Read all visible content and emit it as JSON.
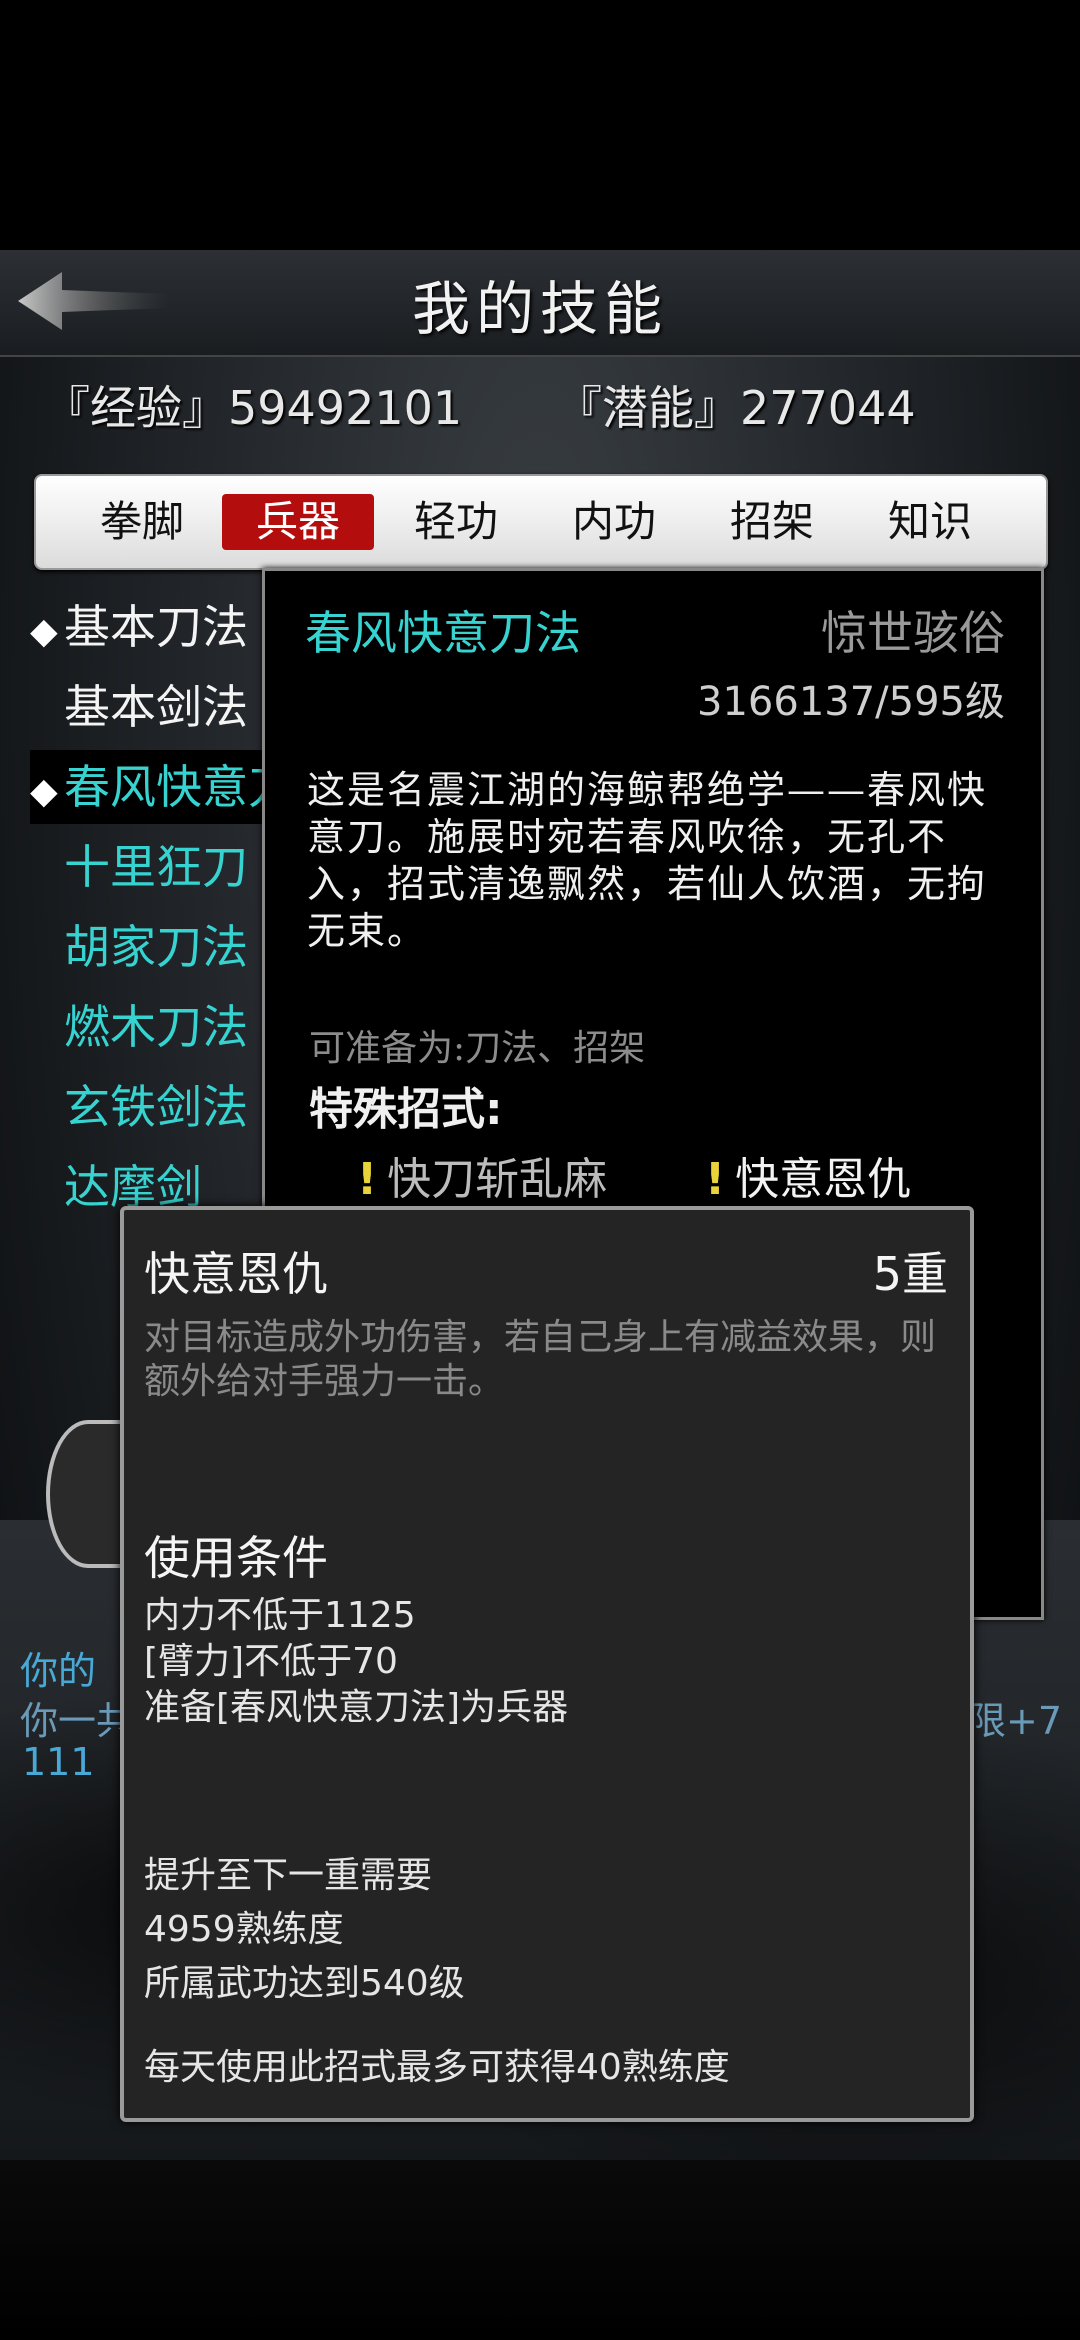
{
  "header": {
    "title": "我的技能",
    "exp": "『经验』59492101",
    "potential": "『潜能』277044"
  },
  "tabs": [
    "拳脚",
    "兵器",
    "轻功",
    "内功",
    "招架",
    "知识"
  ],
  "active_tab": "兵器",
  "skills": [
    {
      "label": "基本刀法",
      "marked": true,
      "color": "white"
    },
    {
      "label": "基本剑法",
      "marked": false,
      "color": "white"
    },
    {
      "label": "春风快意刀法",
      "marked": true,
      "color": "cyan",
      "selected": true
    },
    {
      "label": "十里狂刀",
      "marked": false,
      "color": "cyan"
    },
    {
      "label": "胡家刀法",
      "marked": false,
      "color": "cyan"
    },
    {
      "label": "燃木刀法",
      "marked": false,
      "color": "cyan"
    },
    {
      "label": "玄铁剑法",
      "marked": false,
      "color": "cyan"
    },
    {
      "label": "达摩剑",
      "marked": false,
      "color": "cyan"
    }
  ],
  "background_text": {
    "line1": "你的",
    "line2": "你一共",
    "line3": "111 ",
    "right": "限+7"
  },
  "detail": {
    "name": "春风快意刀法",
    "rank": "惊世骇俗",
    "level": "3166137/595级",
    "description": "这是名震江湖的海鲸帮绝学——春风快意刀。施展时宛若春风吹徐，无孔不入，招式清逸飘然，若仙人饮酒，无拘无束。",
    "prepare": "可准备为:刀法、招架",
    "special_title": "特殊招式:",
    "moves": [
      "快刀斩乱麻",
      "快意恩仇"
    ]
  },
  "tooltip": {
    "name": "快意恩仇",
    "level": "5重",
    "description": "对目标造成外功伤害，若自己身上有减益效果，则额外给对手强力一击。",
    "cond_title": "使用条件",
    "conditions": [
      "内力不低于1125",
      "[臂力]不低于70",
      "准备[春风快意刀法]为兵器"
    ],
    "upgrade_title": "提升至下一重需要",
    "upgrade": [
      "4959熟练度",
      "所属武功达到540级"
    ],
    "daily": "每天使用此招式最多可获得40熟练度"
  },
  "colors": {
    "accent_cyan": "#36d3d0",
    "tab_active": "#b30d0d",
    "bang": "#e8d33a"
  }
}
